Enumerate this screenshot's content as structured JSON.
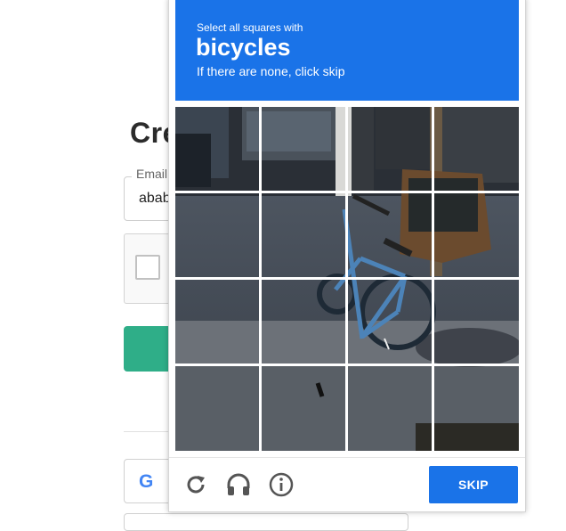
{
  "background_page": {
    "title": "Cre",
    "email_label": "Email",
    "email_value": "abab",
    "google_icon": "G"
  },
  "challenge": {
    "instruction": "Select all squares with",
    "target": "bicycles",
    "subtext": "If there are none, click skip",
    "grid_size": "4x4",
    "image_subject": "blue bicycle parked on sidewalk",
    "footer": {
      "reload_icon": "reload-icon",
      "audio_icon": "headphones-icon",
      "info_icon": "info-icon",
      "skip_label": "SKIP"
    }
  },
  "colors": {
    "accent": "#1a73e8",
    "green_button": "#2fae88",
    "icon_gray": "#555555"
  }
}
